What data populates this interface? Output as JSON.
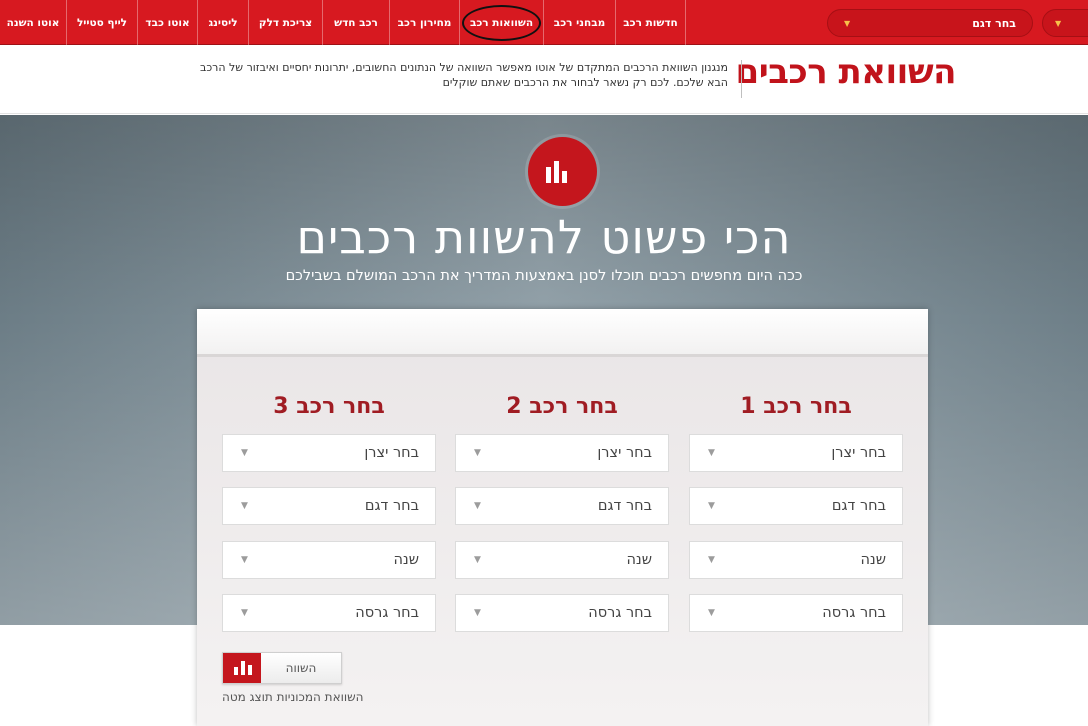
{
  "nav": {
    "items": [
      {
        "label": "אוטו השנה"
      },
      {
        "label": "לייף סטייל"
      },
      {
        "label": "אוטו כבד"
      },
      {
        "label": "ליסינג"
      },
      {
        "label": "צריכת דלק"
      },
      {
        "label": "רכב חדש"
      },
      {
        "label": "מחירון רכב"
      },
      {
        "label": "השוואות רכב"
      },
      {
        "label": "מבחני רכב"
      },
      {
        "label": "חדשות רכב"
      }
    ],
    "model_select": "בחר דגם",
    "caret_glyph": "▼"
  },
  "header": {
    "title": "השוואת רכבים",
    "description": "מנגנון השוואת הרכבים המתקדם של אוטו מאפשר השוואה של הנתונים החשובים, יתרונות יחסיים ואיבזור של הרכב הבא שלכם. לכם רק נשאר לבחור את הרכבים שאתם שוקלים"
  },
  "hero": {
    "headline": "הכי פשוט להשוות רכבים",
    "subheadline": "ככה היום מחפשים רכבים תוכלו לסנן באמצעות המדריך את הרכב המושלם בשבילכם"
  },
  "compare": {
    "columns": [
      {
        "title": "בחר רכב 1",
        "fields": [
          "בחר יצרן",
          "בחר דגם",
          "שנה",
          "בחר גרסה"
        ]
      },
      {
        "title": "בחר רכב 2",
        "fields": [
          "בחר יצרן",
          "בחר דגם",
          "שנה",
          "בחר גרסה"
        ]
      },
      {
        "title": "בחר רכב 3",
        "fields": [
          "בחר יצרן",
          "בחר דגם",
          "שנה",
          "בחר גרסה"
        ]
      }
    ],
    "arrow_glyph": "▼",
    "button_label": "השווה",
    "note": "השוואת המכוניות תוצג מטה"
  },
  "colors": {
    "brand_red": "#d71920",
    "title_red": "#c1131b",
    "column_title": "#a01c23"
  },
  "icons": {
    "hero_logo": "bar-chart-icon",
    "compare_button": "bar-chart-icon"
  }
}
